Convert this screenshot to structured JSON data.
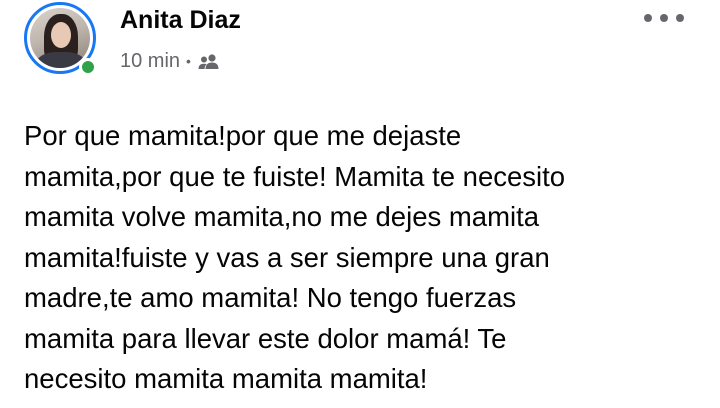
{
  "post": {
    "author": {
      "name": "Anita Diaz",
      "online": true,
      "avatar_icon": "profile-photo"
    },
    "meta": {
      "time": "10 min",
      "separator": "•",
      "audience_icon": "friends-icon"
    },
    "more_icon": "more-options-icon",
    "body": "Por que mamita!por que me dejaste\nmamita,por que te fuiste! Mamita te necesito\nmamita volve mamita,no me dejes mamita\nmamita!fuiste y vas a ser siempre una gran\nmadre,te amo mamita! No tengo fuerzas\nmamita para llevar este dolor mamá! Te\nnecesito mamita mamita mamita!"
  },
  "colors": {
    "accent": "#1877f2",
    "online": "#31a24c",
    "secondary_text": "#65676b",
    "primary_text": "#050505"
  }
}
